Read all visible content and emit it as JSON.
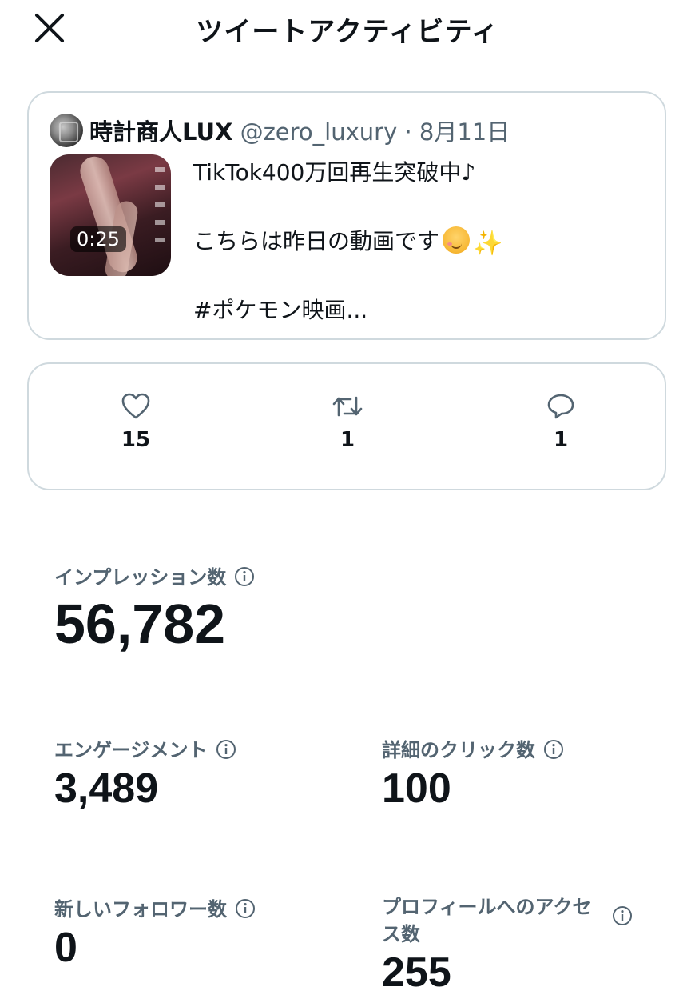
{
  "header": {
    "title": "ツイートアクティビティ",
    "close_icon": "close-icon"
  },
  "tweet": {
    "author_name": "時計商人LUX",
    "handle_date": " @zero_luxury · 8月11日",
    "video_duration": "0:25",
    "text_line1": "TikTok400万回再生突破中♪",
    "text_line2": "こちらは昨日の動画です",
    "text_line3": "#ポケモン映画..."
  },
  "engagement": {
    "likes": "15",
    "retweets": "1",
    "replies": "1"
  },
  "metrics": {
    "impressions_label": "インプレッション数",
    "impressions_value": "56,782",
    "engagements_label": "エンゲージメント",
    "engagements_value": "3,489",
    "detail_clicks_label": "詳細のクリック数",
    "detail_clicks_value": "100",
    "new_followers_label": "新しいフォロワー数",
    "new_followers_value": "0",
    "profile_visits_label_1": "プロフィールへのアクセ",
    "profile_visits_label_2": "ス数",
    "profile_visits_value": "255"
  },
  "colors": {
    "text": "#0f1419",
    "secondary": "#536471",
    "border": "#cfd9de"
  }
}
